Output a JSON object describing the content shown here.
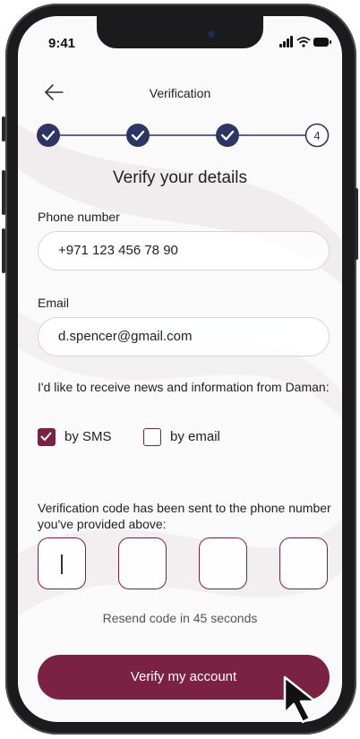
{
  "status_bar": {
    "time": "9:41"
  },
  "header": {
    "title": "Verification"
  },
  "stepper": {
    "steps": [
      "",
      "",
      "",
      "4"
    ],
    "active_step": "4"
  },
  "heading": "Verify your details",
  "phone": {
    "label": "Phone number",
    "value": "+971 123 456 78 90"
  },
  "email": {
    "label": "Email",
    "value": "d.spencer@gmail.com"
  },
  "consent": {
    "text": "I'd like to receive news and information from Daman:",
    "sms_label": "by SMS",
    "email_label": "by email"
  },
  "verification": {
    "note": "Verification code has been sent to the phone number you've provided above:",
    "resend": "Resend code in 45 seconds"
  },
  "cta": {
    "label": "Verify my account"
  },
  "colors": {
    "brand": "#7b2242",
    "field_border": "#d9d2d4"
  }
}
